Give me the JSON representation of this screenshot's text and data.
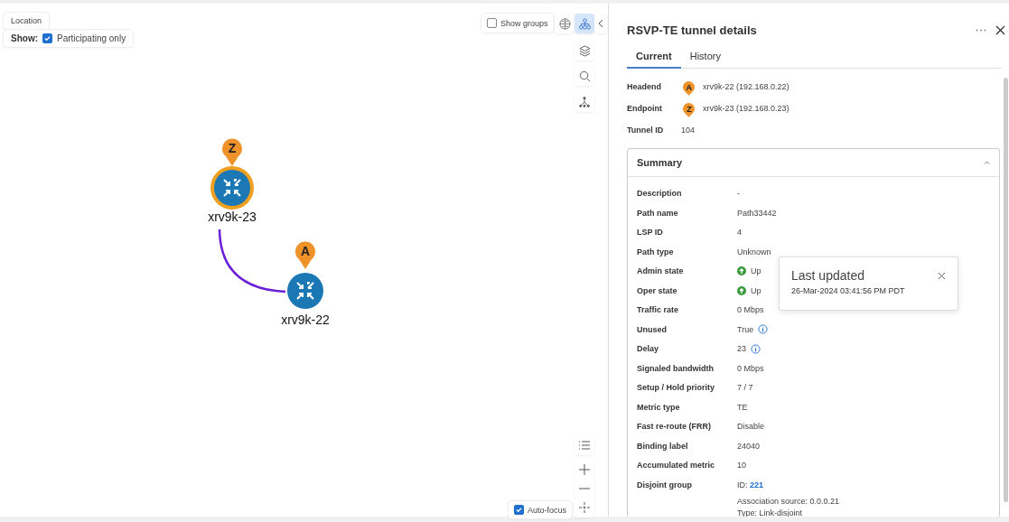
{
  "canvas": {
    "location_label": "Location",
    "show_filter": {
      "label": "Show:",
      "option": "Participating only",
      "checked": true
    },
    "show_groups": {
      "label": "Show groups",
      "checked": false
    },
    "view_modes": [
      {
        "kind": "globe",
        "selected": false
      },
      {
        "kind": "topology",
        "selected": true
      }
    ],
    "nodes": [
      {
        "name": "xrv9k-23",
        "marker": "Z",
        "highlighted": true
      },
      {
        "name": "xrv9k-22",
        "marker": "A",
        "highlighted": false
      }
    ],
    "auto_focus": {
      "label": "Auto-focus",
      "checked": true
    }
  },
  "panel": {
    "title": "RSVP-TE tunnel details",
    "tabs": [
      {
        "label": "Current",
        "selected": true
      },
      {
        "label": "History",
        "selected": false
      }
    ],
    "fields": [
      {
        "label": "Headend",
        "marker": "A",
        "value": "xrv9k-22 (192.168.0.22)"
      },
      {
        "label": "Endpoint",
        "marker": "Z",
        "value": "xrv9k-23 (192.168.0.23)"
      },
      {
        "label": "Tunnel ID",
        "value": "104"
      }
    ],
    "summary": {
      "title": "Summary",
      "expanded": true,
      "rows": [
        {
          "kind": "text",
          "label": "Description",
          "value": "-"
        },
        {
          "kind": "text",
          "label": "Path name",
          "value": "Path33442"
        },
        {
          "kind": "text",
          "label": "LSP ID",
          "value": "4"
        },
        {
          "kind": "text",
          "label": "Path type",
          "value": "Unknown"
        },
        {
          "kind": "status",
          "label": "Admin state",
          "value": "Up"
        },
        {
          "kind": "status",
          "label": "Oper state",
          "value": "Up"
        },
        {
          "kind": "text",
          "label": "Traffic rate",
          "value": "0 Mbps"
        },
        {
          "kind": "info",
          "label": "Unused",
          "value": "True"
        },
        {
          "kind": "info",
          "label": "Delay",
          "value": "23"
        },
        {
          "kind": "text",
          "label": "Signaled bandwidth",
          "value": "0 Mbps"
        },
        {
          "kind": "text",
          "label": "Setup / Hold priority",
          "value": "7 / 7"
        },
        {
          "kind": "text",
          "label": "Metric type",
          "value": "TE"
        },
        {
          "kind": "text",
          "label": "Fast re-route (FRR)",
          "value": "Disable"
        },
        {
          "kind": "text",
          "label": "Binding label",
          "value": "24040"
        },
        {
          "kind": "text",
          "label": "Accumulated metric",
          "value": "10"
        },
        {
          "kind": "group",
          "label": "Disjoint group",
          "value": "ID:",
          "link": "221",
          "notes": [
            "Association source: 0.0.0.21",
            "Type: Link-disjoint"
          ]
        }
      ]
    },
    "popover": {
      "title": "Last updated",
      "text": "26-Mar-2024 03:41:56 PM PDT"
    }
  }
}
